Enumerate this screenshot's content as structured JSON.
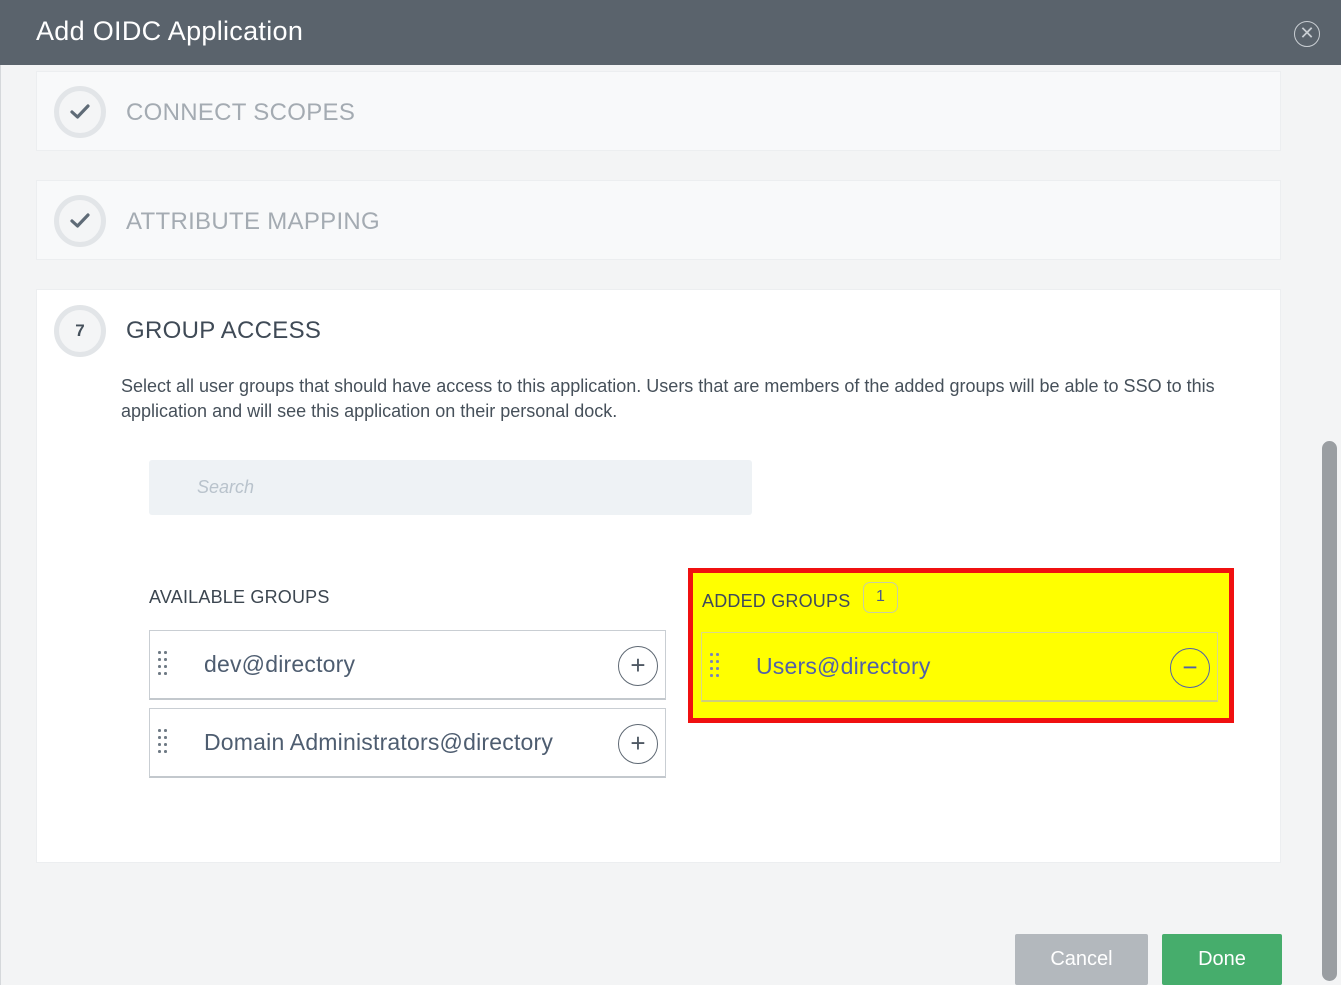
{
  "dialog": {
    "title": "Add OIDC Application",
    "close_icon": "close-circle-icon"
  },
  "steps": [
    {
      "title": "CONNECT SCOPES",
      "status": "complete",
      "icon": "checkmark-icon"
    },
    {
      "title": "ATTRIBUTE MAPPING",
      "status": "complete",
      "icon": "checkmark-icon"
    },
    {
      "number": "7",
      "title": "GROUP ACCESS",
      "status": "active"
    }
  ],
  "group_access": {
    "description": "Select all user groups that should have access to this application. Users that are members of the added groups will be able to SSO to this application and will see this application on their personal dock.",
    "search_placeholder": "Search",
    "available_label": "AVAILABLE GROUPS",
    "available_groups": [
      {
        "name": "dev@directory"
      },
      {
        "name": "Domain Administrators@directory"
      }
    ],
    "added_label": "ADDED GROUPS",
    "added_count": "1",
    "added_groups": [
      {
        "name": "Users@directory"
      }
    ],
    "add_symbol": "+",
    "remove_symbol": "−"
  },
  "footer": {
    "cancel_label": "Cancel",
    "done_label": "Done"
  },
  "colors": {
    "header": "#5a636c",
    "done": "#46ad6c",
    "cancel": "#b3b8bd",
    "highlight_fill": "#ffff00",
    "highlight_border": "#f01010"
  }
}
